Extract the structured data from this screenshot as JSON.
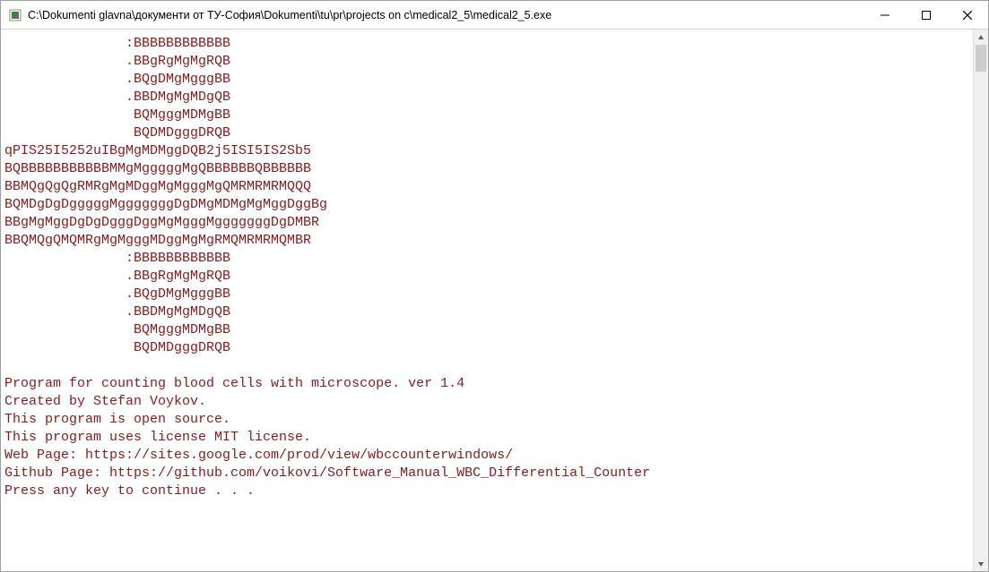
{
  "window": {
    "title": "C:\\Dokumenti glavna\\документи от ТУ-София\\Dokumenti\\tu\\pr\\projects on c\\medical2_5\\medical2_5.exe"
  },
  "console": {
    "ascii_art": [
      "               :BBBBBBBBBBBB",
      "               .BBgRgMgMgRQB",
      "               .BQgDMgMgggBB",
      "               .BBDMgMgMDgQB",
      "                BQMgggMDMgBB",
      "                BQDMDgggDRQB",
      "qPIS25I5252uIBgMgMDMggDQB2j5ISI5IS2Sb5",
      "BQBBBBBBBBBBBMMgMgggggMgQBBBBBBQBBBBBB",
      "BBMQgQgQgRMRgMgMDggMgMgggMgQMRMRMRMQQQ",
      "BQMDgDgDgggggMgggggggDgDMgMDMgMgMggDggBg",
      "BBgMgMggDgDgDgggDggMgMgggMgggggggDgDMBR",
      "BBQMQgQMQMRgMgMgggMDggMgMgRMQMRMRMQMBR",
      "               :BBBBBBBBBBBB",
      "               .BBgRgMgMgRQB",
      "               .BQgDMgMgggBB",
      "               .BBDMgMgMDgQB",
      "                BQMgggMDMgBB",
      "                BQDMDgggDRQB"
    ],
    "info_lines": [
      "Program for counting blood cells with microscope. ver 1.4",
      "Created by Stefan Voykov.",
      "This program is open source.",
      "This program uses license MIT license.",
      "Web Page: https://sites.google.com/prod/view/wbccounterwindows/",
      "Github Page: https://github.com/voikovi/Software_Manual_WBC_Differential_Counter",
      "Press any key to continue . . ."
    ]
  }
}
